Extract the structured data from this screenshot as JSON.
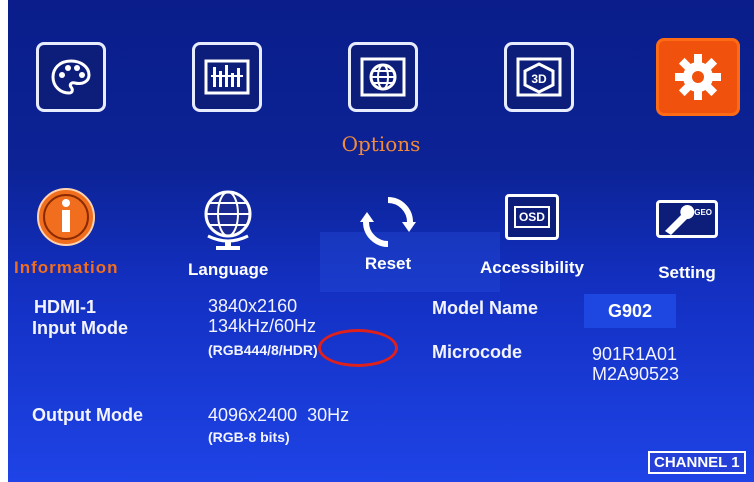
{
  "top_menu": {
    "items": [
      {
        "name": "picture",
        "icon": "palette-icon"
      },
      {
        "name": "sound",
        "icon": "equalizer-icon"
      },
      {
        "name": "network",
        "icon": "globe-grid-icon"
      },
      {
        "name": "3d",
        "icon": "3d-icon"
      },
      {
        "name": "options",
        "icon": "gear-icon",
        "active": true
      }
    ],
    "title": "Options"
  },
  "sub_menu": {
    "information": "Information",
    "language": "Language",
    "reset": "Reset",
    "accessibility": "Accessibility",
    "osd_icon_text": "OSD",
    "setting": "Setting",
    "setting_icon_text": "GEO"
  },
  "info": {
    "source_label": "HDMI-1",
    "input_mode_label": "Input Mode",
    "input_resolution": "3840x2160",
    "input_freq": "134kHz/60Hz",
    "input_format": "(RGB444/8/HDR)",
    "output_mode_label": "Output Mode",
    "output_resolution": "4096x2400  30Hz",
    "output_format": "(RGB-8 bits)",
    "model_name_label": "Model Name",
    "model_name_value": "G902",
    "microcode_label": "Microcode",
    "microcode_line1": "901R1A01",
    "microcode_line2": "M2A90523"
  },
  "status": {
    "channel": "CHANNEL 1"
  },
  "colors": {
    "active_orange": "#f0520e",
    "background_blue": "#1330c2",
    "highlight_red": "#e0201a"
  }
}
